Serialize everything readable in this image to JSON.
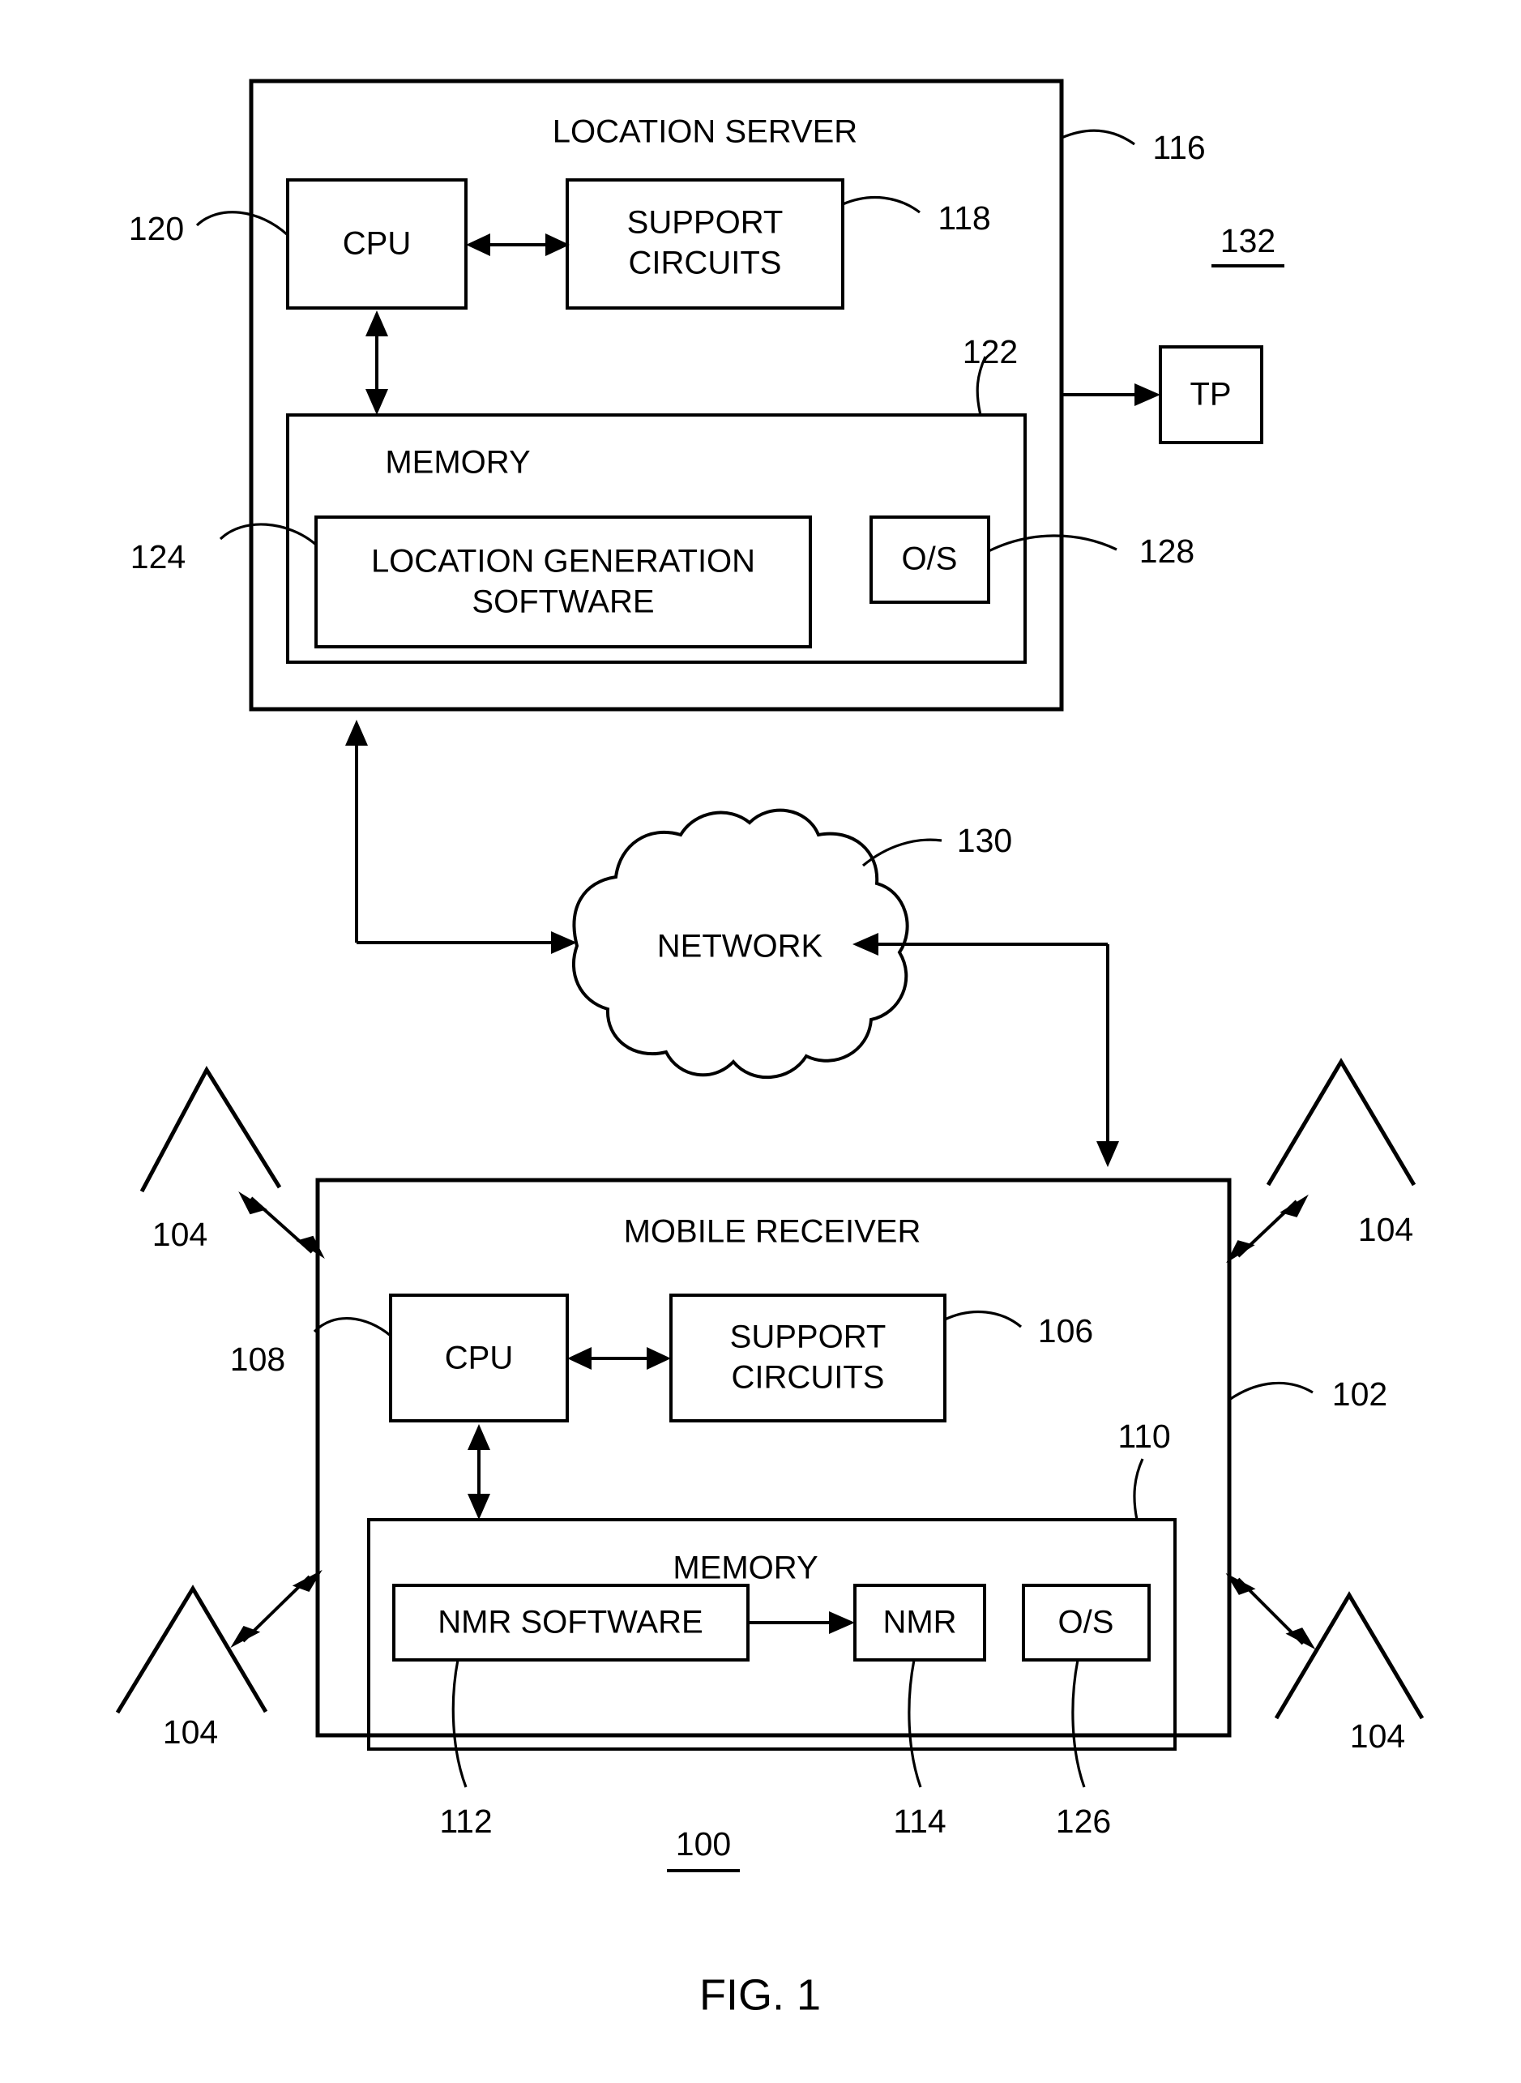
{
  "figure": {
    "caption": "FIG. 1",
    "system_ref": "100",
    "top_assembly_ref": "132"
  },
  "location_server": {
    "title": "LOCATION SERVER",
    "ref": "116",
    "cpu": {
      "label": "CPU",
      "ref": "120"
    },
    "support_circuits": {
      "label": "SUPPORT CIRCUITS",
      "line1": "SUPPORT",
      "line2": "CIRCUITS",
      "ref": "118"
    },
    "memory": {
      "label": "MEMORY",
      "ref": "122"
    },
    "location_generation_software": {
      "line1": "LOCATION GENERATION",
      "line2": "SOFTWARE",
      "ref": "124"
    },
    "os": {
      "label": "O/S",
      "ref": "128"
    }
  },
  "tp": {
    "label": "TP"
  },
  "network": {
    "label": "NETWORK",
    "ref": "130"
  },
  "mobile_receiver": {
    "title": "MOBILE RECEIVER",
    "ref": "102",
    "cpu": {
      "label": "CPU",
      "ref": "108"
    },
    "support_circuits": {
      "line1": "SUPPORT",
      "line2": "CIRCUITS",
      "ref": "106"
    },
    "memory": {
      "label": "MEMORY",
      "ref": "110"
    },
    "nmr_software": {
      "label": "NMR SOFTWARE",
      "ref": "112"
    },
    "nmr": {
      "label": "NMR",
      "ref": "114"
    },
    "os": {
      "label": "O/S",
      "ref": "126"
    }
  },
  "antennas": [
    {
      "ref": "104",
      "position": "top-left"
    },
    {
      "ref": "104",
      "position": "top-right"
    },
    {
      "ref": "104",
      "position": "bottom-left"
    },
    {
      "ref": "104",
      "position": "bottom-right"
    }
  ]
}
